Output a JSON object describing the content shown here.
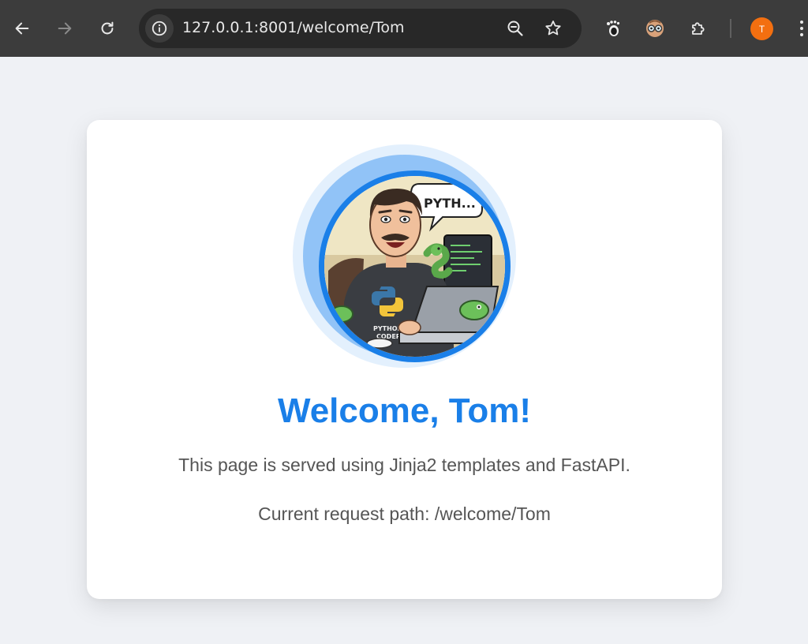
{
  "browser": {
    "url": "127.0.0.1:8001/welcome/Tom",
    "profile_initial": "T",
    "icons": {
      "back": "arrow-left-icon",
      "forward": "arrow-right-icon",
      "reload": "reload-icon",
      "site_info": "info-icon",
      "zoom": "zoom-icon",
      "bookmark": "star-icon",
      "extension_1": "gnome-foot-icon",
      "extension_2": "owl-glasses-icon",
      "extensions": "puzzle-icon",
      "menu": "kebab-menu-icon"
    },
    "colors": {
      "chrome": "#3c3c3c",
      "omnibox": "#282828",
      "profile": "#f36f10"
    }
  },
  "page": {
    "title": "Welcome, Tom!",
    "description": "This page is served using Jinja2 templates and FastAPI.",
    "path_line": "Current request path: /welcome/Tom",
    "avatar": {
      "speech_bubble": "PYTH...",
      "shirt_text_1": "PYTHON",
      "shirt_text_2": "CODER"
    },
    "colors": {
      "background": "#eff1f5",
      "accent": "#1a7fe8",
      "text": "#555555"
    }
  }
}
